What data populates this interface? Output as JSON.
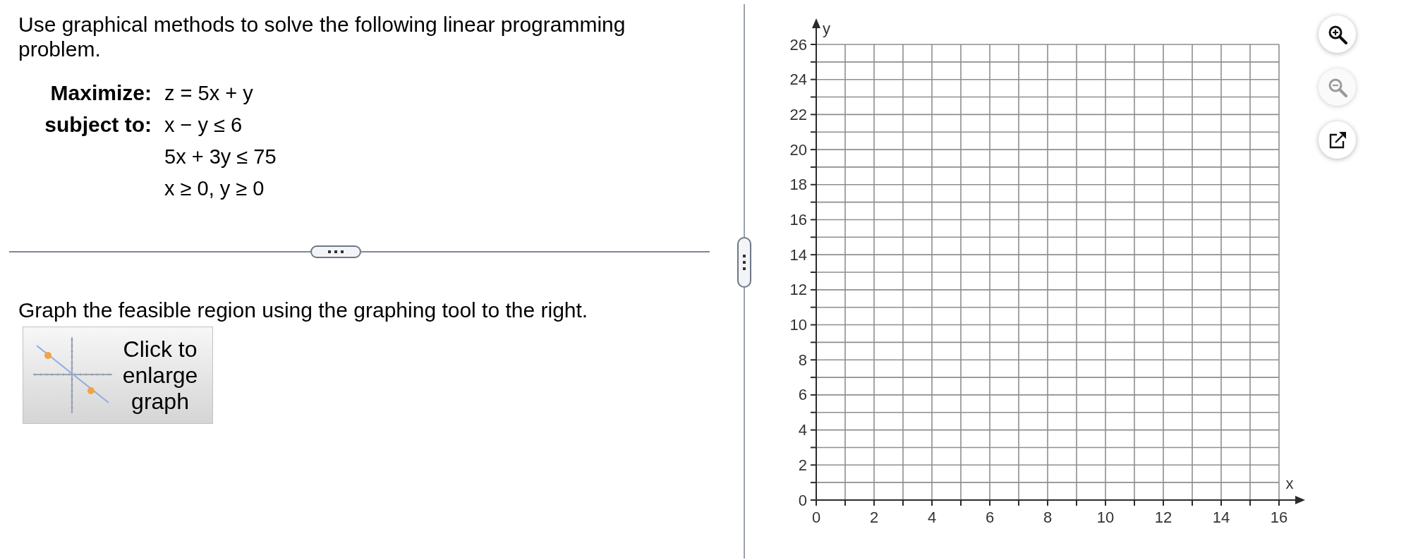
{
  "problem": {
    "instruction": "Use graphical methods to solve the following linear programming problem.",
    "rows": [
      {
        "label": "Maximize:",
        "expression": "z = 5x + y"
      },
      {
        "label": "subject to:",
        "expression": "x − y ≤ 6"
      },
      {
        "expression": "5x + 3y ≤ 75"
      },
      {
        "expression": "x ≥ 0, y ≥ 0"
      }
    ]
  },
  "answer": {
    "instruction": "Graph the feasible region using the graphing tool to the right.",
    "enlarge_button": "Click to enlarge graph"
  },
  "graph": {
    "y_axis": {
      "label": "y",
      "ticks": [
        "26",
        "24",
        "22",
        "20",
        "18",
        "16",
        "14",
        "12",
        "10",
        "8",
        "6",
        "4",
        "2",
        "0"
      ]
    },
    "x_axis": {
      "label": "x",
      "ticks": [
        "0",
        "2",
        "4",
        "6",
        "8",
        "10",
        "12",
        "14",
        "16"
      ]
    }
  },
  "graph_tools": [
    {
      "kind": "zoom_in",
      "disabled": false
    },
    {
      "kind": "zoom_out",
      "disabled": true
    },
    {
      "kind": "popout",
      "disabled": false
    }
  ]
}
